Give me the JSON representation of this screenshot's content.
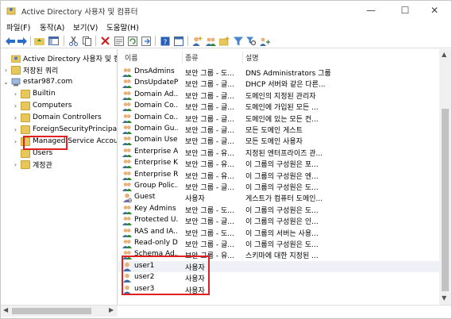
{
  "window": {
    "title": "Active Directory 사용자 및 컴퓨터"
  },
  "menu": [
    "파일(F)",
    "동작(A)",
    "보기(V)",
    "도움말(H)"
  ],
  "toolbar_icons": [
    "back-arrow-icon",
    "forward-arrow-icon",
    "up-folder-icon",
    "console-tree-icon",
    "cut-icon",
    "copy-icon",
    "delete-icon",
    "properties-icon",
    "refresh-icon",
    "export-list-icon",
    "help-icon",
    "console-icon",
    "add-user-icon",
    "add-group-icon",
    "add-ou-icon",
    "filter-icon",
    "find-icon",
    "add-to-group-icon"
  ],
  "tree": {
    "root": "Active Directory 사용자 및 컴퓨",
    "saved_queries": "저장된 쿼리",
    "domain": "estar987.com",
    "items": [
      "Builtin",
      "Computers",
      "Domain Controllers",
      "ForeignSecurityPrincipal",
      "Managed Service Accou",
      "Users",
      "계정관"
    ]
  },
  "columns": {
    "name": "이름",
    "type": "종류",
    "desc": "설명"
  },
  "rows": [
    {
      "name": "DnsAdmins",
      "type": "보안 그룹 - 도...",
      "desc": "DNS Administrators 그룹"
    },
    {
      "name": "DnsUpdateP...",
      "type": "보안 그룹 - 글...",
      "desc": "DHCP 서버와 같은 다른..."
    },
    {
      "name": "Domain Ad...",
      "type": "보안 그룹 - 글...",
      "desc": "도메인의 지정된 관리자"
    },
    {
      "name": "Domain Co...",
      "type": "보안 그룹 - 글...",
      "desc": "도메인에 가입된 모든 ..."
    },
    {
      "name": "Domain Co...",
      "type": "보안 그룹 - 글...",
      "desc": "도메인에 있는 모든 컨..."
    },
    {
      "name": "Domain Gu...",
      "type": "보안 그룹 - 글...",
      "desc": "모든 도메인 게스트"
    },
    {
      "name": "Domain Users",
      "type": "보안 그룹 - 글...",
      "desc": "모든 도메인 사용자"
    },
    {
      "name": "Enterprise A...",
      "type": "보안 그룹 - 유...",
      "desc": "지정된 엔터프라이즈 관..."
    },
    {
      "name": "Enterprise K...",
      "type": "보안 그룹 - 유...",
      "desc": "이 그룹의 구성원은 포..."
    },
    {
      "name": "Enterprise R...",
      "type": "보안 그룹 - 유...",
      "desc": "이 그룹의 구성원은 엔..."
    },
    {
      "name": "Group Polic...",
      "type": "보안 그룹 - 글...",
      "desc": "이 그룹의 구성원은 도..."
    },
    {
      "name": "Guest",
      "type": "사용자",
      "desc": "게스트가 컴퓨터 도메인..."
    },
    {
      "name": "Key Admins",
      "type": "보안 그룹 - 도...",
      "desc": "이 그룹의 구성원은 도..."
    },
    {
      "name": "Protected U...",
      "type": "보안 그룹 - 글...",
      "desc": "이 그룹의 구성원은 인..."
    },
    {
      "name": "RAS and IA...",
      "type": "보안 그룹 - 도...",
      "desc": "이 그룹의 서버는 사용..."
    },
    {
      "name": "Read-only D...",
      "type": "보안 그룹 - 글...",
      "desc": "이 그룹의 구성원은 도..."
    },
    {
      "name": "Schema Ad...",
      "type": "보안 그룹 - 유...",
      "desc": "스키마에 대한 지정된 ..."
    },
    {
      "name": "user1",
      "type": "사용자",
      "desc": ""
    },
    {
      "name": "user2",
      "type": "사용자",
      "desc": ""
    },
    {
      "name": "user3",
      "type": "사용자",
      "desc": ""
    }
  ],
  "colors": {
    "highlight": "#e02020",
    "folder": "#e7c65a"
  }
}
